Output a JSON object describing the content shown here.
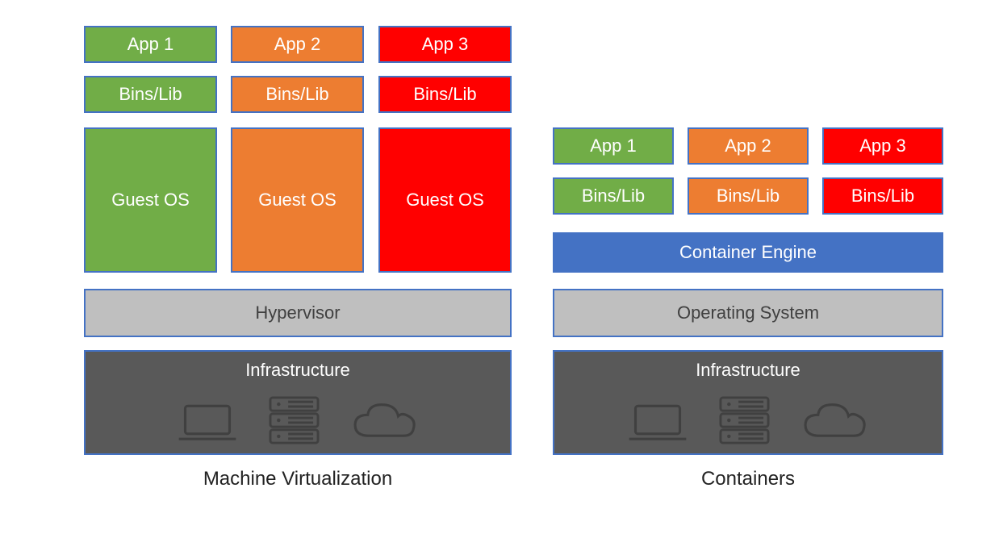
{
  "colors": {
    "green": "#71AD47",
    "orange": "#ED7D31",
    "red": "#FF0000",
    "blue": "#4472C4",
    "lightGrey": "#BFBFBF",
    "darkGrey": "#595959",
    "border": "#4472C4"
  },
  "left": {
    "caption": "Machine Virtualization",
    "apps": [
      "App 1",
      "App 2",
      "App 3"
    ],
    "bins": [
      "Bins/Lib",
      "Bins/Lib",
      "Bins/Lib"
    ],
    "guest": [
      "Guest OS",
      "Guest OS",
      "Guest OS"
    ],
    "hypervisor": "Hypervisor",
    "infrastructure": "Infrastructure"
  },
  "right": {
    "caption": "Containers",
    "apps": [
      "App 1",
      "App 2",
      "App 3"
    ],
    "bins": [
      "Bins/Lib",
      "Bins/Lib",
      "Bins/Lib"
    ],
    "containerEngine": "Container Engine",
    "operatingSystem": "Operating System",
    "infrastructure": "Infrastructure"
  },
  "icons": [
    "laptop-icon",
    "server-icon",
    "cloud-icon"
  ]
}
